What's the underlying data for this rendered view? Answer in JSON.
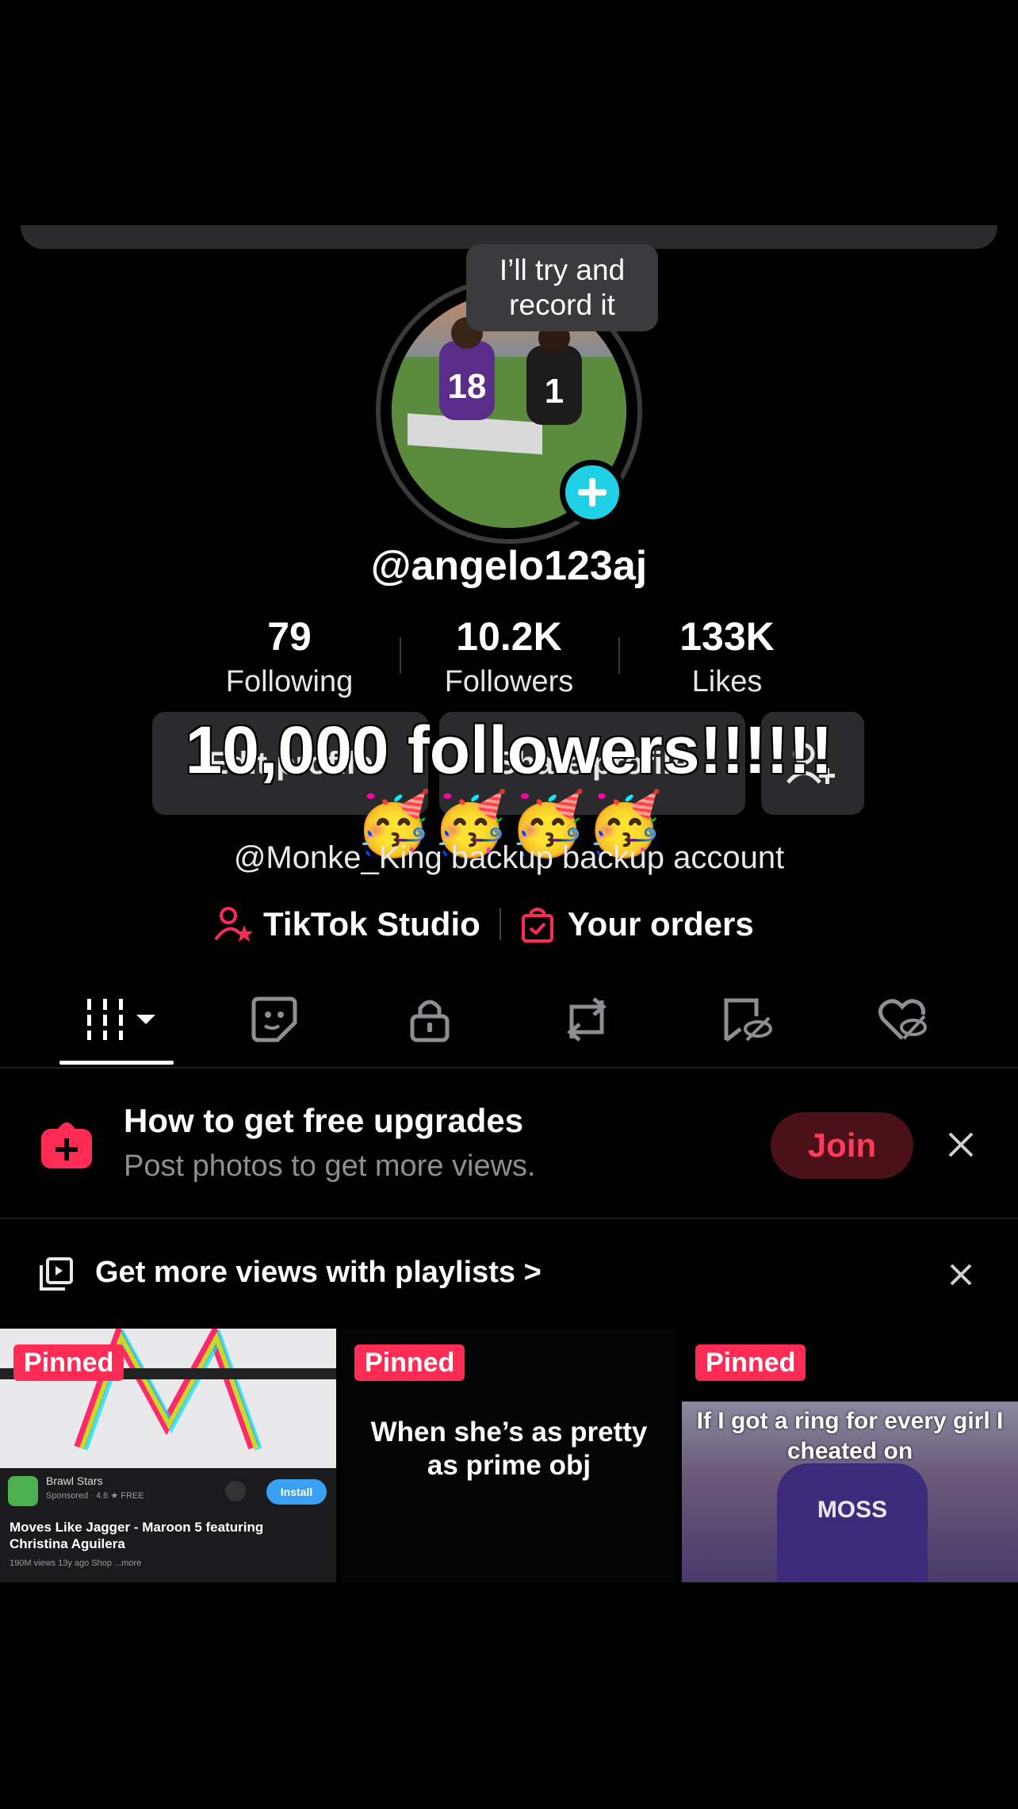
{
  "bubble_text": "I’ll try and record it",
  "profile": {
    "username": "@angelo123aj"
  },
  "stats": [
    {
      "value": "79",
      "label": "Following"
    },
    {
      "value": "10.2K",
      "label": "Followers"
    },
    {
      "value": "133K",
      "label": "Likes"
    }
  ],
  "buttons": {
    "edit_profile": "Edit profile",
    "share_profile": "Share profile"
  },
  "overlay": {
    "text": "10,000 followers!!!!!!",
    "emoji": "🥳🥳🥳🥳"
  },
  "bio": "@Monke_King backup backup account",
  "links": {
    "studio": "TikTok Studio",
    "orders": "Your orders"
  },
  "tabs": [
    "videos-icon",
    "stickers-icon",
    "private-icon",
    "reposts-icon",
    "favorites-icon",
    "liked-icon"
  ],
  "promo": {
    "title": "How to get free upgrades",
    "subtitle": "Post photos to get more views.",
    "join_label": "Join"
  },
  "playlist": {
    "label": "Get more views with playlists >"
  },
  "videos": [
    {
      "badge": "Pinned",
      "ad_app": "Brawl Stars",
      "ad_meta": "Sponsored · 4.6 ★  FREE",
      "ad_install": "Install",
      "ad_title": "Moves Like Jagger - Maroon 5 featuring Christina Aguilera",
      "ad_stats": "190M views 13y ago  Shop  ...more"
    },
    {
      "badge": "Pinned",
      "caption": "When she’s as pretty as prime obj"
    },
    {
      "badge": "Pinned",
      "caption": "If I got a ring for every girl I cheated on",
      "jersey": "MOSS"
    }
  ],
  "colors": {
    "accent": "#fe2c55",
    "cyan": "#1fd0e6",
    "background": "#000000"
  }
}
